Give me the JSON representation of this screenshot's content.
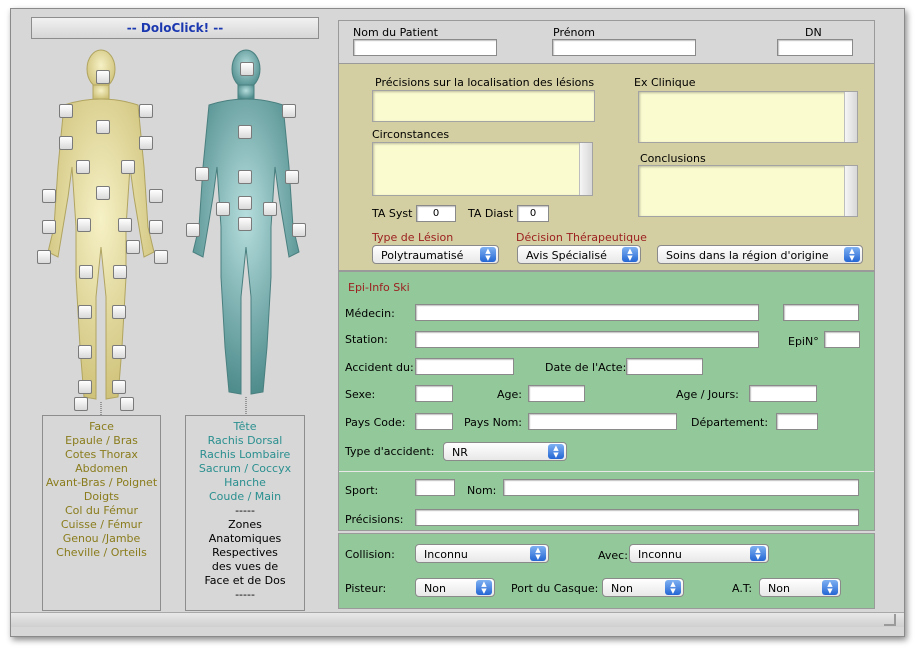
{
  "app": {
    "title": "-- DoloClick! --"
  },
  "patient": {
    "nom_label": "Nom du Patient",
    "nom_value": "",
    "prenom_label": "Prénom",
    "prenom_value": "",
    "dn_label": "DN",
    "dn_value": ""
  },
  "clinical": {
    "precisions_label": "Précisions sur la localisation des lésions",
    "circonstances_label": "Circonstances",
    "ex_clinique_label": "Ex Clinique",
    "conclusions_label": "Conclusions",
    "ta_syst_label": "TA Syst",
    "ta_syst_value": "0",
    "ta_diast_label": "TA Diast",
    "ta_diast_value": "0",
    "type_lesion_label": "Type de Lésion",
    "type_lesion_value": "Polytraumatisé",
    "decision_label": "Décision Thérapeutique",
    "decision_value": "Avis Spécialisé",
    "soins_value": "Soins dans la région d'origine"
  },
  "epi": {
    "title": "Epi-Info Ski",
    "medecin_label": "Médecin:",
    "station_label": "Station:",
    "epin_label": "EpiN°",
    "accident_label": "Accident du:",
    "date_acte_label": "Date de l'Acte:",
    "sexe_label": "Sexe:",
    "age_label": "Age:",
    "age_jours_label": "Age / Jours:",
    "pays_code_label": "Pays Code:",
    "pays_nom_label": "Pays Nom:",
    "departement_label": "Département:",
    "type_accident_label": "Type d'accident:",
    "type_accident_value": "NR",
    "sport_label": "Sport:",
    "nom_label": "Nom:",
    "precisions_label": "Précisions:"
  },
  "bottom": {
    "collision_label": "Collision:",
    "collision_value": "Inconnu",
    "avec_label": "Avec:",
    "avec_value": "Inconnu",
    "pisteur_label": "Pisteur:",
    "pisteur_value": "Non",
    "casque_label": "Port du Casque:",
    "casque_value": "Non",
    "at_label": "A.T:",
    "at_value": "Non"
  },
  "face_list": [
    "Face",
    "Epaule / Bras",
    "Cotes Thorax",
    "Abdomen",
    "Avant-Bras / Poignet",
    "Doigts",
    "Col du Fémur",
    "Cuisse / Fémur",
    "Genou /Jambe",
    "Cheville / Orteils"
  ],
  "back_list": {
    "teal_items": [
      "Tête",
      "Rachis Dorsal",
      "Rachis Lombaire",
      "Sacrum / Coccyx",
      "Hanche",
      "Coude / Main"
    ],
    "note": [
      "-----",
      "Zones",
      "Anatomiques",
      "Respectives",
      "des vues de",
      "Face et de Dos",
      "-----"
    ]
  },
  "colors": {
    "face_body": "#efe8a8",
    "back_body": "#8fc4c4",
    "clinical_bg": "#d4cfa2",
    "epi_bg": "#93c99a",
    "field_yellow": "#fbfbd0"
  }
}
